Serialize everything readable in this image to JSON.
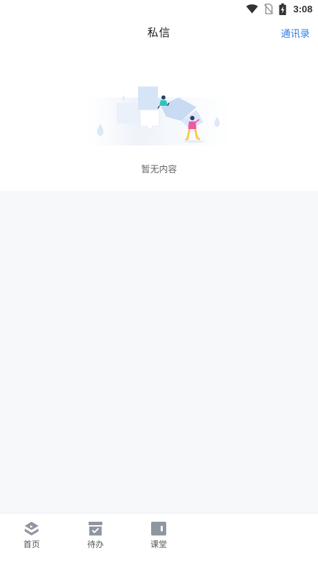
{
  "status_bar": {
    "time": "3:08",
    "icons": [
      "wifi-icon",
      "no-sim-icon",
      "battery-charging-icon"
    ]
  },
  "header": {
    "title": "私信",
    "action_label": "通讯录"
  },
  "empty_state": {
    "text": "暂无内容",
    "illustration": "puzzle-illustration"
  },
  "bottom_nav": {
    "items": [
      {
        "label": "首页",
        "icon": "home-icon"
      },
      {
        "label": "待办",
        "icon": "todo-icon"
      },
      {
        "label": "课堂",
        "icon": "classroom-icon"
      }
    ]
  },
  "colors": {
    "accent": "#2f7fe8",
    "background": "#f6f8fa",
    "icon_gray": "#8f96a0"
  }
}
